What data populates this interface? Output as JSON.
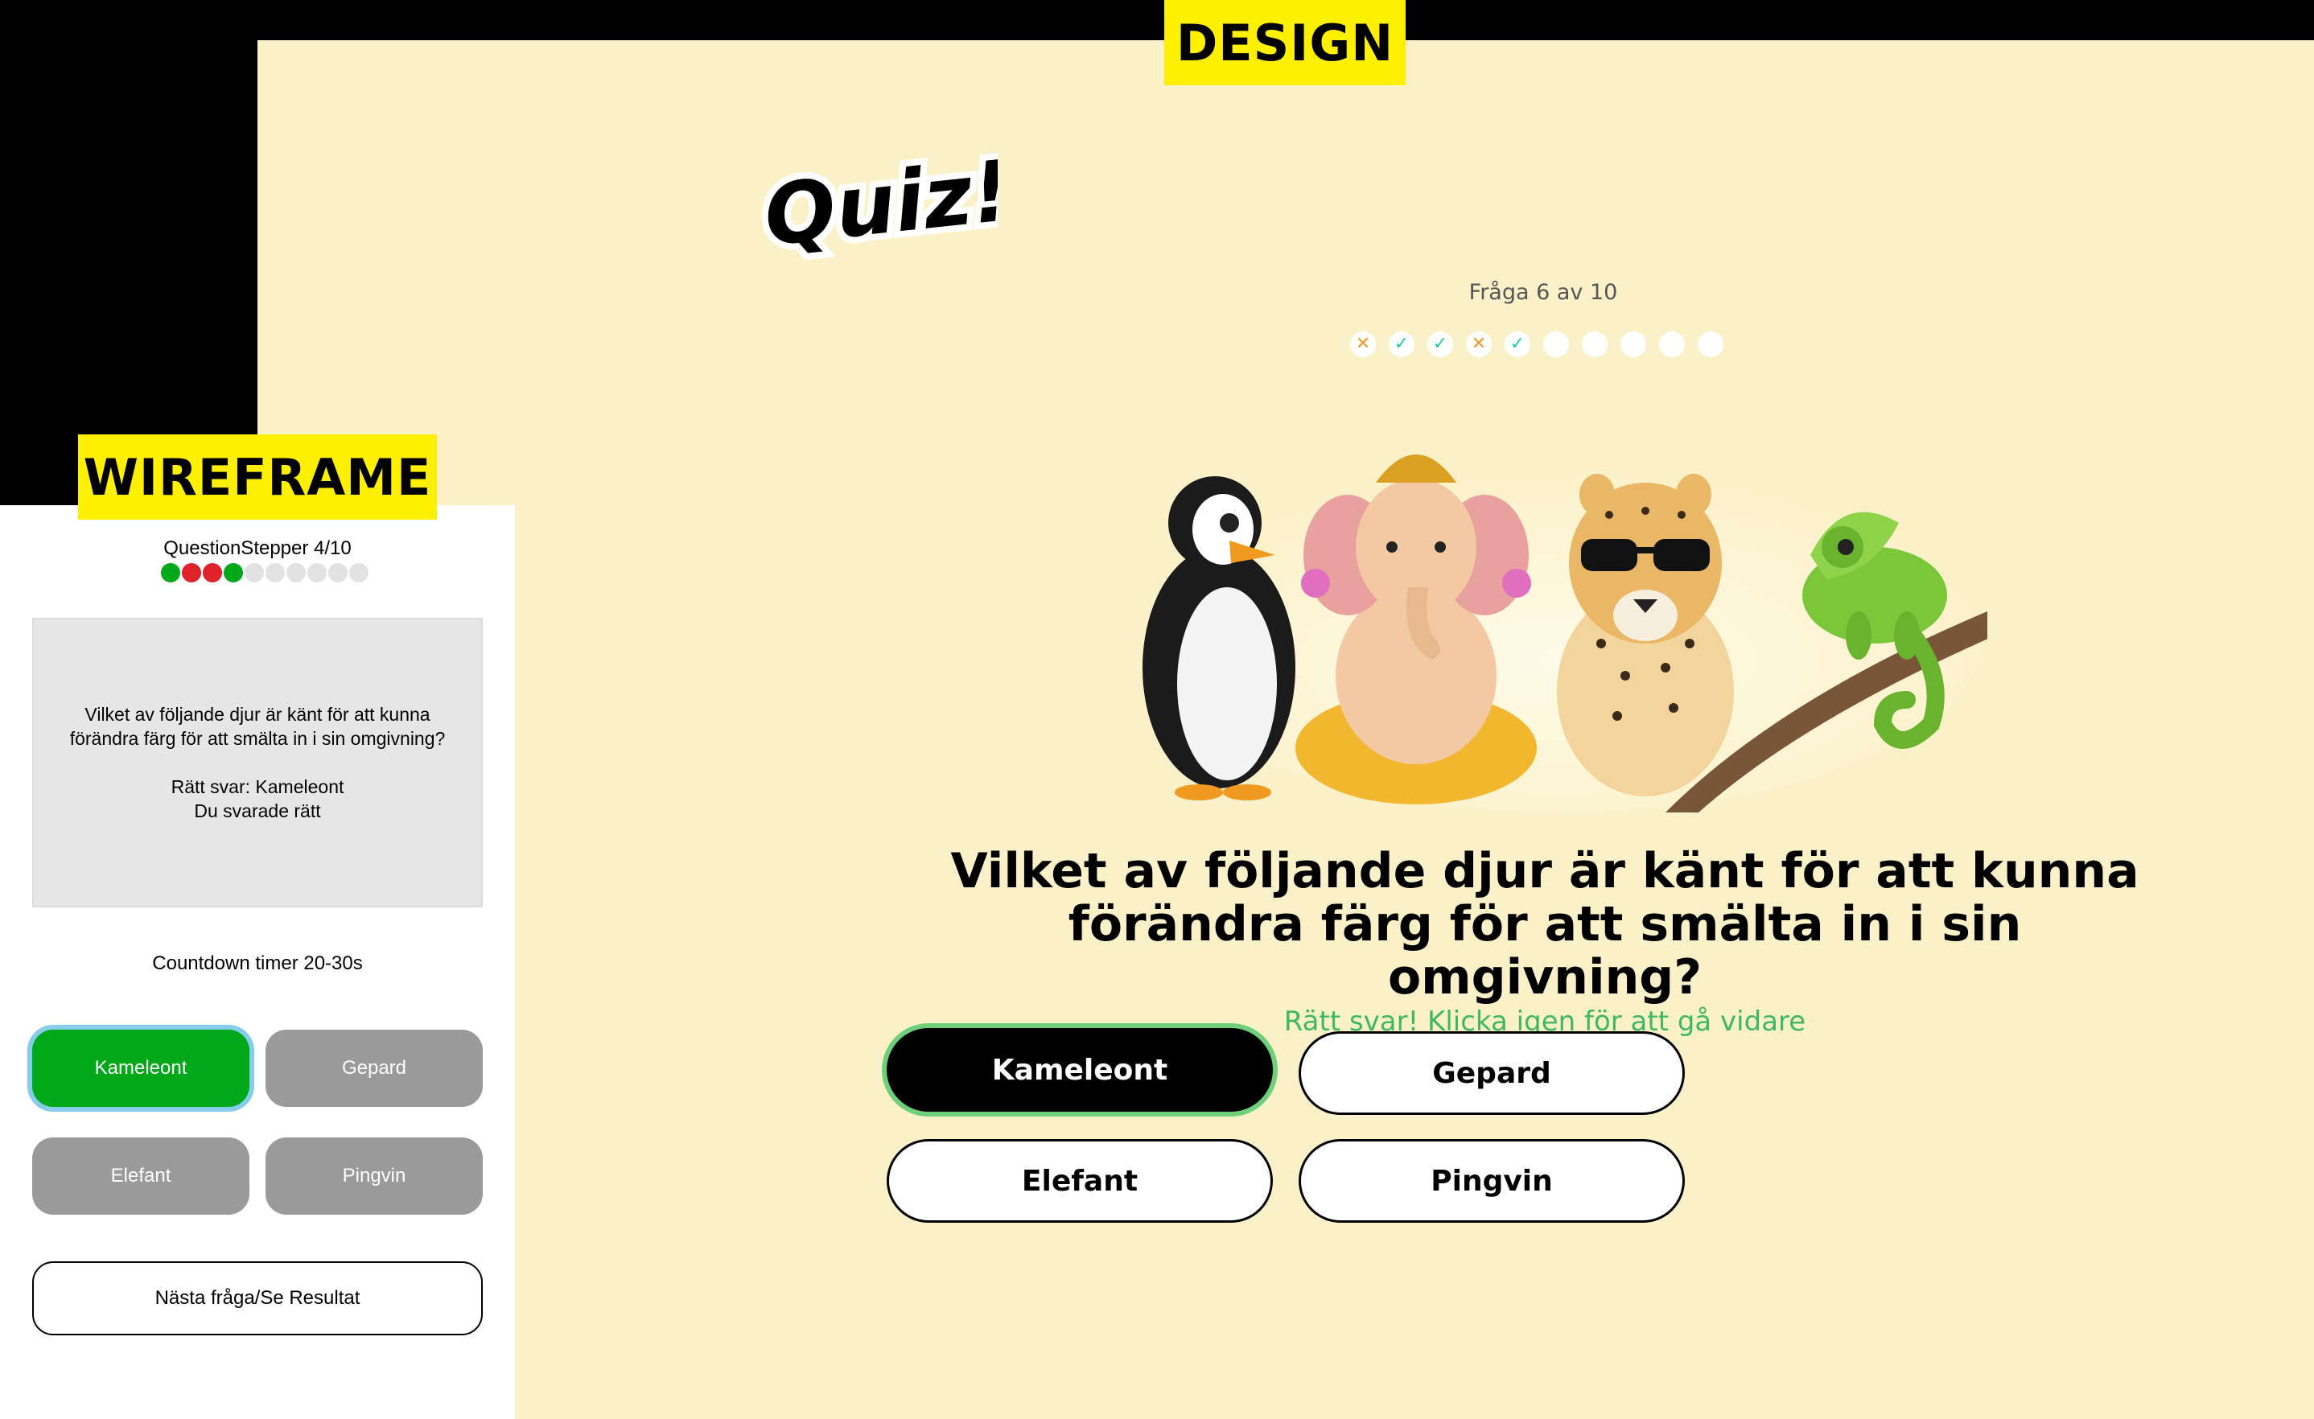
{
  "tags": {
    "design": "DESIGN",
    "wireframe": "WIREFRAME"
  },
  "design": {
    "logo_text": "Quiz!",
    "stepper_label": "Fråga 6 av 10",
    "stepper_results": [
      "wrong",
      "right",
      "right",
      "wrong",
      "right",
      "empty",
      "empty",
      "empty",
      "empty",
      "empty"
    ],
    "question": "Vilket av följande djur är känt för att kunna förändra färg för att smälta in i sin omgivning?",
    "feedback": "Rätt svar! Klicka igen för att gå vidare",
    "answers": [
      "Kameleont",
      "Gepard",
      "Elefant",
      "Pingvin"
    ],
    "selected_answer": "Kameleont",
    "colors": {
      "background": "#fbf1c9",
      "correct": "#3fb95e",
      "wrong_mark": "#f29a2e",
      "right_mark": "#28c7a9"
    }
  },
  "wireframe": {
    "stepper_label": "QuestionStepper 4/10",
    "stepper_dots": [
      "green",
      "red",
      "red",
      "green",
      "gray",
      "gray",
      "gray",
      "gray",
      "gray",
      "gray"
    ],
    "card_line1": "Vilket av följande djur är känt för att kunna",
    "card_line2": "förändra färg för att smälta in i sin omgivning?",
    "card_answer": "Rätt svar: Kameleont",
    "card_result": "Du svarade rätt",
    "timer": "Countdown timer 20-30s",
    "answers": [
      "Kameleont",
      "Gepard",
      "Elefant",
      "Pingvin"
    ],
    "next_button": "Nästa fråga/Se Resultat"
  }
}
